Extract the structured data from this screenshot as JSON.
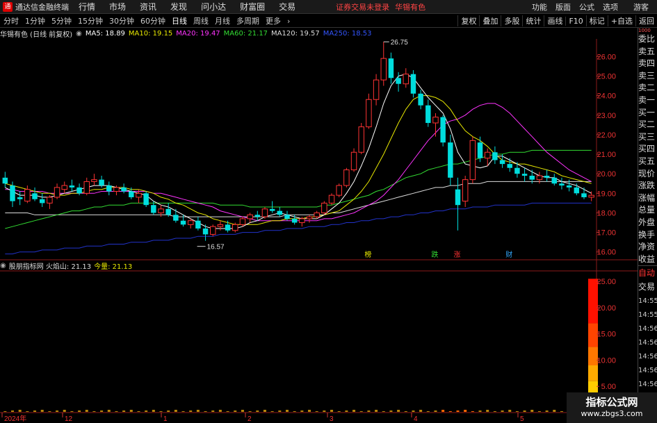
{
  "menubar": {
    "app_name": "通达信金融终端",
    "items": [
      "行情",
      "市场",
      "资讯",
      "发现",
      "问小达",
      "财富圈",
      "交易"
    ],
    "alert": "证券交易未登录",
    "stock_name": "华锡有色",
    "right_items": [
      "功能",
      "版面",
      "公式",
      "选项",
      "游客"
    ]
  },
  "toolbar": {
    "periods": [
      "分时",
      "1分钟",
      "5分钟",
      "15分钟",
      "30分钟",
      "60分钟",
      "日线",
      "周线",
      "月线",
      "多周期",
      "更多"
    ],
    "active": "日线",
    "right_tools": [
      "复权",
      "叠加",
      "多股",
      "统计",
      "画线",
      "F10",
      "标记",
      "+自选",
      "返回"
    ]
  },
  "info": {
    "title": "华锡有色 (日线 前复权)",
    "ma": [
      {
        "label": "MA5: 18.89",
        "color": "#ffffff"
      },
      {
        "label": "MA10: 19.15",
        "color": "#e8e800"
      },
      {
        "label": "MA20: 19.47",
        "color": "#ff33ff"
      },
      {
        "label": "MA60: 21.17",
        "color": "#33dd33"
      },
      {
        "label": "MA120: 19.57",
        "color": "#dddddd"
      },
      {
        "label": "MA250: 18.53",
        "color": "#3355ff"
      }
    ]
  },
  "sub_info": {
    "title": "股朋指标网 火焰山: 21.13",
    "vol_label": "今量: 21.13"
  },
  "annotations": {
    "high": "26.75",
    "low": "16.57",
    "markers": [
      "榜",
      "跌",
      "涨",
      "财"
    ]
  },
  "axis": {
    "price_ticks": [
      "26.00",
      "25.00",
      "24.00",
      "23.00",
      "22.00",
      "21.00",
      "20.00",
      "19.00",
      "18.00",
      "17.00",
      "16.00"
    ],
    "sub_ticks": [
      "25.00",
      "20.00",
      "15.00",
      "10.00",
      "5.00"
    ],
    "dates": [
      "2024年",
      "12",
      "1",
      "2",
      "3",
      "4",
      "5"
    ]
  },
  "sidebar": {
    "top_label": "1000",
    "items": [
      "委比",
      "卖五",
      "卖四",
      "卖三",
      "卖二",
      "卖一",
      "买一",
      "买二",
      "买三",
      "买四",
      "买五",
      "现价",
      "涨跌",
      "涨幅",
      "总量",
      "外盘",
      "换手",
      "净资",
      "收益"
    ],
    "auto": "自动",
    "trade": "交易",
    "times": [
      "14:55",
      "14:55",
      "14:56",
      "14:56",
      "14:56",
      "14:56",
      "14:56",
      "14:56"
    ]
  },
  "watermark": {
    "line1": "指标公式网",
    "line2": "www.zbgs3.com"
  },
  "colors": {
    "up": "#ff3333",
    "down": "#00dddd",
    "ma5": "#ffffff",
    "ma10": "#e8e800",
    "ma20": "#ff33ff",
    "ma60": "#33dd33",
    "ma120": "#dddddd",
    "ma250": "#2233cc"
  },
  "chart_data": {
    "type": "candlestick",
    "title": "华锡有色 (日线 前复权)",
    "ylim": [
      15.6,
      26.9
    ],
    "candles": [
      [
        19.8,
        20.1,
        19.3,
        19.5
      ],
      [
        19.4,
        19.6,
        18.3,
        18.6
      ],
      [
        18.8,
        19.1,
        18.4,
        18.7
      ],
      [
        18.6,
        19.4,
        18.5,
        19.2
      ],
      [
        19.0,
        19.3,
        18.6,
        18.7
      ],
      [
        18.7,
        19.0,
        18.3,
        18.5
      ],
      [
        18.5,
        18.9,
        18.2,
        18.8
      ],
      [
        18.8,
        19.5,
        18.7,
        19.3
      ],
      [
        19.2,
        19.6,
        19.0,
        19.4
      ],
      [
        19.4,
        19.7,
        19.1,
        19.3
      ],
      [
        19.3,
        19.5,
        18.9,
        19.0
      ],
      [
        19.0,
        19.8,
        18.9,
        19.6
      ],
      [
        19.6,
        20.0,
        19.4,
        19.7
      ],
      [
        19.7,
        19.9,
        19.3,
        19.4
      ],
      [
        19.4,
        19.6,
        18.9,
        19.1
      ],
      [
        19.1,
        19.4,
        18.9,
        19.3
      ],
      [
        19.3,
        19.5,
        19.0,
        19.1
      ],
      [
        19.1,
        19.3,
        18.7,
        18.8
      ],
      [
        18.8,
        19.2,
        18.5,
        19.0
      ],
      [
        19.0,
        19.1,
        18.3,
        18.4
      ],
      [
        18.4,
        18.6,
        17.9,
        18.0
      ],
      [
        18.0,
        18.4,
        17.8,
        18.2
      ],
      [
        18.2,
        18.5,
        17.8,
        17.9
      ],
      [
        17.9,
        18.2,
        17.5,
        17.6
      ],
      [
        17.6,
        17.9,
        17.3,
        17.4
      ],
      [
        17.4,
        17.7,
        17.2,
        17.6
      ],
      [
        17.6,
        17.8,
        17.1,
        17.2
      ],
      [
        17.2,
        17.4,
        16.57,
        16.9
      ],
      [
        16.9,
        17.4,
        16.8,
        17.3
      ],
      [
        17.3,
        17.6,
        17.1,
        17.4
      ],
      [
        17.4,
        17.6,
        17.0,
        17.1
      ],
      [
        17.1,
        17.5,
        17.0,
        17.4
      ],
      [
        17.4,
        17.8,
        17.3,
        17.7
      ],
      [
        17.7,
        18.0,
        17.5,
        17.9
      ],
      [
        17.9,
        18.1,
        17.6,
        17.8
      ],
      [
        17.8,
        18.3,
        17.7,
        18.2
      ],
      [
        18.2,
        18.6,
        18.0,
        18.1
      ],
      [
        18.1,
        18.3,
        17.8,
        17.9
      ],
      [
        17.9,
        18.1,
        17.6,
        17.7
      ],
      [
        17.7,
        17.9,
        17.4,
        17.5
      ],
      [
        17.5,
        17.8,
        17.3,
        17.7
      ],
      [
        17.7,
        17.9,
        17.5,
        17.8
      ],
      [
        17.8,
        18.1,
        17.7,
        18.0
      ],
      [
        18.0,
        18.6,
        17.9,
        18.5
      ],
      [
        18.5,
        19.0,
        18.4,
        18.9
      ],
      [
        18.9,
        19.5,
        18.8,
        19.4
      ],
      [
        19.4,
        20.3,
        19.3,
        20.2
      ],
      [
        20.2,
        21.3,
        20.1,
        21.1
      ],
      [
        21.1,
        22.6,
        21.0,
        22.4
      ],
      [
        22.4,
        24.1,
        22.3,
        23.8
      ],
      [
        23.8,
        25.1,
        23.5,
        24.8
      ],
      [
        24.8,
        26.75,
        24.5,
        25.9
      ],
      [
        25.9,
        26.2,
        24.6,
        24.9
      ],
      [
        24.9,
        25.2,
        24.2,
        24.6
      ],
      [
        24.6,
        25.4,
        24.4,
        25.1
      ],
      [
        25.1,
        25.3,
        23.9,
        24.1
      ],
      [
        24.1,
        24.3,
        23.3,
        23.5
      ],
      [
        23.5,
        23.8,
        22.4,
        22.6
      ],
      [
        22.6,
        23.1,
        21.9,
        22.9
      ],
      [
        22.9,
        23.0,
        21.4,
        21.6
      ],
      [
        21.6,
        22.0,
        19.4,
        19.8
      ],
      [
        19.2,
        19.8,
        17.1,
        18.4
      ],
      [
        18.6,
        19.9,
        18.3,
        19.7
      ],
      [
        19.7,
        21.9,
        19.5,
        21.7
      ],
      [
        21.6,
        21.9,
        20.6,
        20.8
      ],
      [
        20.8,
        21.3,
        20.4,
        21.1
      ],
      [
        21.1,
        21.4,
        20.5,
        20.7
      ],
      [
        20.7,
        21.0,
        20.3,
        20.5
      ],
      [
        20.5,
        20.8,
        20.1,
        20.3
      ],
      [
        20.3,
        20.6,
        19.8,
        20.0
      ],
      [
        20.0,
        20.3,
        19.6,
        19.9
      ],
      [
        19.9,
        20.2,
        19.5,
        19.7
      ],
      [
        19.7,
        20.1,
        19.5,
        19.9
      ],
      [
        19.9,
        20.2,
        19.6,
        19.8
      ],
      [
        19.8,
        20.0,
        19.4,
        19.5
      ],
      [
        19.5,
        19.8,
        19.2,
        19.4
      ],
      [
        19.4,
        19.7,
        19.1,
        19.3
      ],
      [
        19.3,
        19.5,
        18.9,
        19.0
      ],
      [
        19.0,
        19.3,
        18.7,
        18.8
      ],
      [
        18.8,
        19.1,
        18.6,
        18.9
      ]
    ],
    "ma5": [
      19.3,
      19.1,
      18.9,
      18.9,
      18.9,
      18.8,
      18.8,
      18.9,
      19.0,
      19.1,
      19.2,
      19.3,
      19.4,
      19.4,
      19.4,
      19.3,
      19.2,
      19.1,
      19.0,
      18.9,
      18.6,
      18.4,
      18.3,
      18.1,
      17.9,
      17.7,
      17.5,
      17.3,
      17.2,
      17.2,
      17.2,
      17.2,
      17.3,
      17.5,
      17.6,
      17.8,
      17.9,
      18.0,
      17.9,
      17.8,
      17.7,
      17.7,
      17.7,
      17.9,
      18.2,
      18.5,
      19.0,
      19.6,
      20.4,
      21.3,
      22.4,
      23.6,
      24.5,
      25.0,
      25.1,
      24.9,
      24.4,
      23.9,
      23.5,
      23.1,
      22.3,
      21.1,
      20.5,
      20.4,
      20.3,
      20.4,
      20.9,
      20.9,
      20.7,
      20.5,
      20.3,
      20.1,
      19.9,
      19.8,
      19.8,
      19.6,
      19.5,
      19.4,
      19.2,
      19.0
    ],
    "ma10": [
      19.5,
      19.4,
      19.3,
      19.2,
      19.1,
      19.0,
      19.0,
      18.9,
      18.9,
      19.0,
      19.0,
      19.1,
      19.2,
      19.2,
      19.3,
      19.3,
      19.3,
      19.2,
      19.2,
      19.1,
      19.0,
      18.8,
      18.7,
      18.5,
      18.4,
      18.2,
      18.0,
      17.9,
      17.7,
      17.6,
      17.5,
      17.4,
      17.4,
      17.4,
      17.4,
      17.5,
      17.6,
      17.6,
      17.7,
      17.7,
      17.7,
      17.8,
      17.8,
      17.9,
      18.0,
      18.1,
      18.4,
      18.7,
      19.1,
      19.6,
      20.3,
      21.0,
      21.8,
      22.6,
      23.3,
      23.8,
      24.0,
      24.0,
      23.9,
      23.7,
      23.3,
      22.7,
      22.2,
      21.9,
      21.7,
      21.4,
      21.0,
      20.7,
      20.6,
      20.5,
      20.5,
      20.4,
      20.3,
      20.2,
      20.1,
      19.9,
      19.8,
      19.7,
      19.6,
      19.5
    ],
    "ma20": [
      19.2,
      19.2,
      19.1,
      19.1,
      19.1,
      19.1,
      19.0,
      19.0,
      19.0,
      19.0,
      19.0,
      19.0,
      19.0,
      19.1,
      19.1,
      19.1,
      19.1,
      19.1,
      19.1,
      19.1,
      19.0,
      19.0,
      18.9,
      18.8,
      18.7,
      18.6,
      18.5,
      18.4,
      18.3,
      18.1,
      18.0,
      17.9,
      17.8,
      17.7,
      17.6,
      17.6,
      17.6,
      17.6,
      17.6,
      17.6,
      17.6,
      17.6,
      17.6,
      17.7,
      17.7,
      17.8,
      17.9,
      18.0,
      18.2,
      18.4,
      18.6,
      18.9,
      19.3,
      19.7,
      20.2,
      20.7,
      21.2,
      21.7,
      22.1,
      22.5,
      22.7,
      22.8,
      23.0,
      23.3,
      23.5,
      23.6,
      23.6,
      23.4,
      23.1,
      22.7,
      22.3,
      21.9,
      21.5,
      21.1,
      20.8,
      20.5,
      20.2,
      20.0,
      19.8,
      19.6
    ],
    "ma60": [
      17.2,
      17.3,
      17.4,
      17.5,
      17.6,
      17.7,
      17.8,
      17.9,
      18.0,
      18.1,
      18.1,
      18.2,
      18.3,
      18.3,
      18.4,
      18.4,
      18.4,
      18.5,
      18.5,
      18.5,
      18.5,
      18.5,
      18.5,
      18.5,
      18.5,
      18.5,
      18.5,
      18.5,
      18.5,
      18.4,
      18.4,
      18.4,
      18.4,
      18.3,
      18.3,
      18.3,
      18.3,
      18.3,
      18.3,
      18.3,
      18.3,
      18.3,
      18.3,
      18.4,
      18.4,
      18.5,
      18.6,
      18.7,
      18.8,
      18.9,
      19.1,
      19.2,
      19.4,
      19.6,
      19.8,
      19.9,
      20.0,
      20.2,
      20.3,
      20.4,
      20.5,
      20.5,
      20.6,
      20.7,
      20.8,
      20.9,
      21.0,
      21.0,
      21.1,
      21.1,
      21.1,
      21.2,
      21.2,
      21.2,
      21.2,
      21.2,
      21.2,
      21.2,
      21.2,
      21.2
    ],
    "ma120": [
      18.0,
      18.0,
      18.0,
      18.0,
      17.9,
      17.9,
      17.9,
      17.9,
      17.9,
      17.9,
      17.9,
      17.9,
      17.9,
      17.9,
      17.9,
      17.9,
      17.9,
      17.9,
      17.9,
      17.9,
      17.9,
      17.9,
      17.9,
      17.8,
      17.8,
      17.8,
      17.8,
      17.8,
      17.8,
      17.8,
      17.8,
      17.8,
      17.8,
      17.8,
      17.8,
      17.8,
      17.8,
      17.8,
      17.9,
      17.9,
      17.9,
      17.9,
      17.9,
      17.9,
      18.0,
      18.0,
      18.1,
      18.2,
      18.3,
      18.4,
      18.5,
      18.6,
      18.7,
      18.8,
      18.9,
      19.0,
      19.1,
      19.2,
      19.3,
      19.3,
      19.4,
      19.4,
      19.5,
      19.5,
      19.5,
      19.6,
      19.6,
      19.6,
      19.6,
      19.6,
      19.6,
      19.6,
      19.6,
      19.6,
      19.6,
      19.6,
      19.6,
      19.6,
      19.6,
      19.6
    ],
    "ma250": [
      15.9,
      15.9,
      16.0,
      16.0,
      16.0,
      16.1,
      16.1,
      16.1,
      16.2,
      16.2,
      16.2,
      16.3,
      16.3,
      16.3,
      16.4,
      16.4,
      16.4,
      16.5,
      16.5,
      16.5,
      16.6,
      16.6,
      16.6,
      16.7,
      16.7,
      16.7,
      16.8,
      16.8,
      16.8,
      16.9,
      16.9,
      16.9,
      17.0,
      17.0,
      17.0,
      17.1,
      17.1,
      17.1,
      17.2,
      17.2,
      17.2,
      17.3,
      17.3,
      17.3,
      17.4,
      17.4,
      17.5,
      17.5,
      17.6,
      17.6,
      17.7,
      17.7,
      17.8,
      17.8,
      17.9,
      17.9,
      18.0,
      18.0,
      18.1,
      18.1,
      18.2,
      18.2,
      18.2,
      18.3,
      18.3,
      18.3,
      18.4,
      18.4,
      18.4,
      18.4,
      18.4,
      18.5,
      18.5,
      18.5,
      18.5,
      18.5,
      18.5,
      18.5,
      18.5,
      18.5
    ],
    "sub_series": {
      "name": "火焰山",
      "levels": [
        25.5,
        17,
        12.5,
        9,
        6,
        3.5
      ],
      "colors": [
        "#ff1100",
        "#ff4400",
        "#ff7700",
        "#ffaa00",
        "#ffcc00",
        "#ffee00"
      ],
      "ylim": [
        0,
        27
      ]
    }
  }
}
